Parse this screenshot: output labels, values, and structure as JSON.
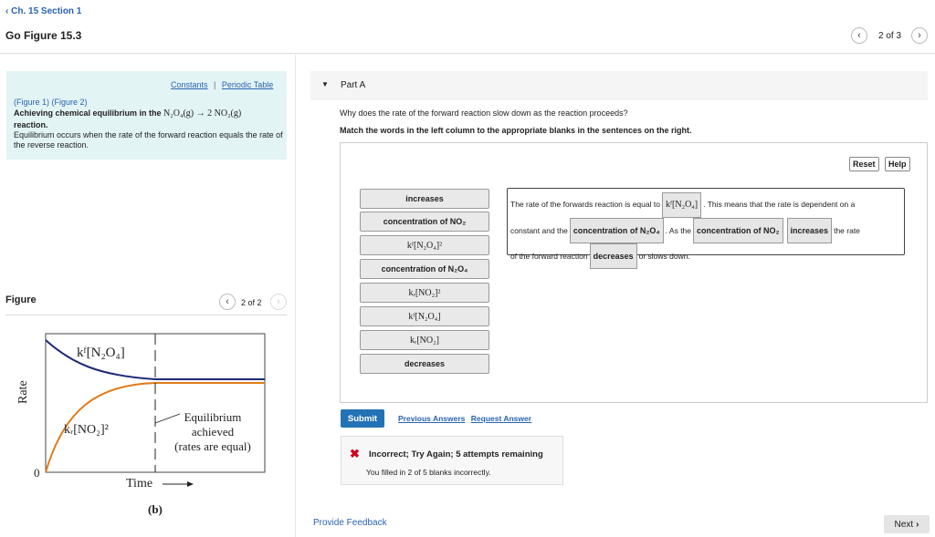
{
  "header": {
    "back_link": "Ch. 15 Section 1",
    "title": "Go Figure 15.3",
    "pager": "2 of 3"
  },
  "left": {
    "constants_link": "Constants",
    "separator": "|",
    "periodic_link": "Periodic Table",
    "figure1_link": "(Figure 1)",
    "figure2_link": "(Figure 2)",
    "heading_prefix": "Achieving chemical equilibrium in the ",
    "heading_formula": "N₂O₄(g) → 2 NO₂(g)",
    "heading_suffix": "reaction.",
    "body": "Equilibrium occurs when the rate of the forward reaction equals the rate of the reverse reaction.",
    "figure_label": "Figure",
    "figure_pager": "2 of 2"
  },
  "graph": {
    "forward_label": "kᶠ[N₂O₄]",
    "reverse_label": "kᵣ[NO₂]²",
    "equilibrium_line1": "Equilibrium",
    "equilibrium_line2": "achieved",
    "equilibrium_line3": "(rates are equal)",
    "y_axis": "Rate",
    "zero": "0",
    "x_axis": "Time",
    "caption": "(b)",
    "colors": {
      "forward": "#1f2a78",
      "reverse": "#e07b1a"
    }
  },
  "part": {
    "label": "Part A",
    "question": "Why does the rate of the forward reaction slow down as the reaction proceeds?",
    "instruction": "Match the words in the left column to the appropriate blanks in the sentences on the right.",
    "reset": "Reset",
    "help": "Help"
  },
  "bank": [
    "increases",
    "concentration of NO₂",
    "kᶠ[N₂O₄]²",
    "concentration of N₂O₄",
    "kᵣ[NO₂]²",
    "kᶠ[N₂O₄]",
    "kᵣ[NO₂]",
    "decreases"
  ],
  "sentence": {
    "t1": "The rate of the forwards reaction is equal to",
    "s1": "kᶠ[N₂O₄]",
    "t2": ". This means that the rate is dependent on a",
    "t3": "constant and the",
    "s2": "concentration of N₂O₄",
    "t4": ". As the",
    "s3": "concentration of NO₂",
    "s4": "increases",
    "t5": "the rate",
    "t6": "of the forward reaction",
    "s5": "decreases",
    "t7": "or slows down."
  },
  "actions": {
    "submit": "Submit",
    "previous_answers": "Previous Answers",
    "request_answer": "Request Answer"
  },
  "feedback": {
    "title": "Incorrect; Try Again; 5 attempts remaining",
    "detail": "You filled in 2 of 5 blanks incorrectly.",
    "color": "#d0021b"
  },
  "footer": {
    "provide_feedback": "Provide Feedback",
    "next": "Next"
  }
}
